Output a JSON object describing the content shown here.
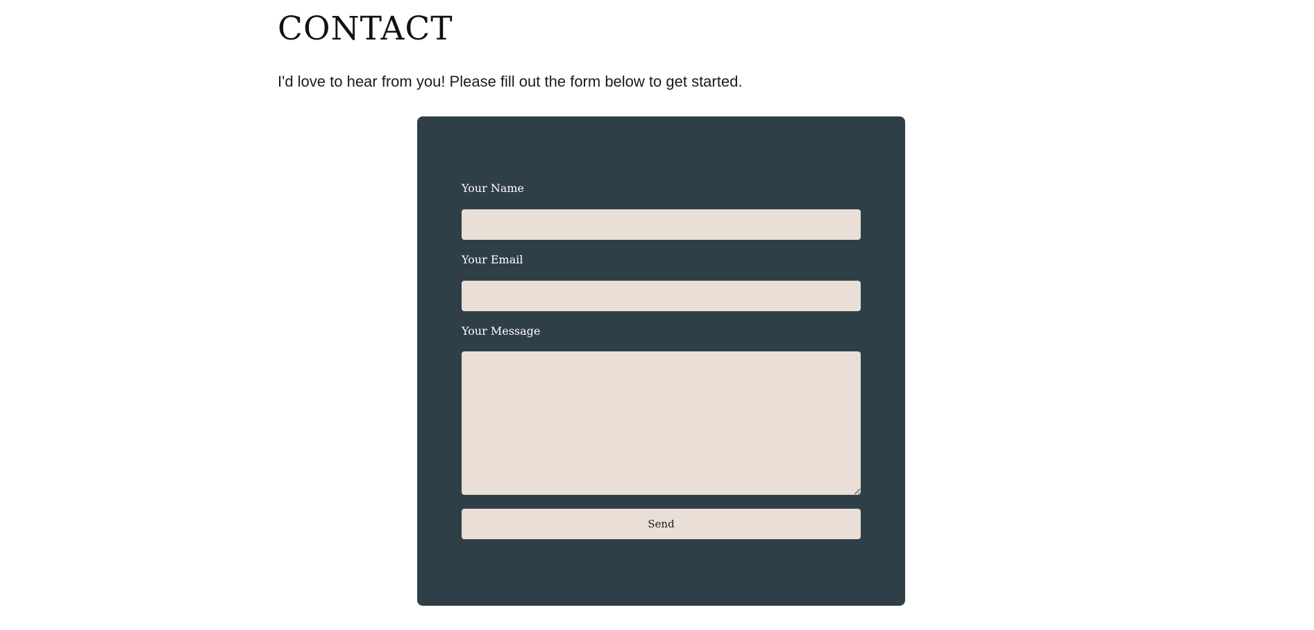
{
  "page": {
    "title": "CONTACT",
    "intro": "I'd love to hear from you! Please fill out the form below to get started."
  },
  "form": {
    "name_label": "Your Name",
    "name_value": "",
    "email_label": "Your Email",
    "email_value": "",
    "message_label": "Your Message",
    "message_value": "",
    "send_label": "Send"
  },
  "colors": {
    "panel_background": "#2f3f48",
    "field_background": "#eadfd6",
    "label_text": "#ffffff"
  }
}
